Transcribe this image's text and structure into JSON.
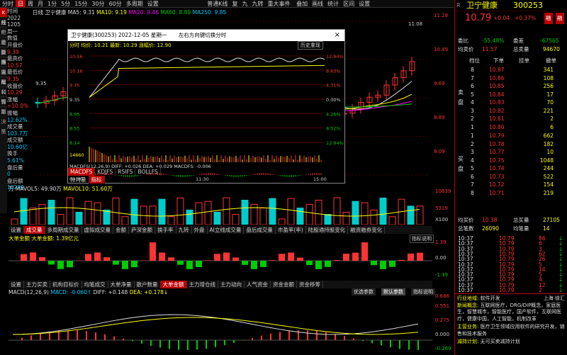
{
  "topbar": {
    "tabs": [
      "分时",
      "日",
      "周",
      "月",
      "1分",
      "5分",
      "15分",
      "30分",
      "60分",
      "多周期",
      "设置"
    ],
    "active": "日",
    "stock_label": "卫宁健康",
    "center": [
      "普通K线",
      "复",
      "九",
      "九转",
      "重大事件"
    ],
    "right_tools": [
      "叠加",
      "画线",
      "统计",
      "区间",
      "设置"
    ]
  },
  "left_tabs": [
    "K线",
    "分时",
    "个股资料",
    "港股通",
    "操作提醒",
    "资讯",
    "主题",
    "盈利预测",
    "公告",
    "智能决策"
  ],
  "info": {
    "date_label": "时间",
    "year": "2022",
    "mmdd": "1205",
    "weekday": "周一",
    "value_label": "数值",
    "open_label": "开盘价",
    "open": "9.39",
    "high_label": "最高价",
    "high": "10.57",
    "low_label": "最低价",
    "low": "9.35",
    "close_label": "收盘价",
    "close": "10.29",
    "chg_label": "涨幅",
    "chg": "+10.0%",
    "amp_label": "振幅",
    "amp": "12.62%",
    "vol_label": "成交量",
    "vol": "103.7万",
    "amt_label": "成交额",
    "amt": "10.60亿",
    "turn_label": "换手",
    "turn": "5.61%",
    "pvol_label": "盘后量",
    "pvol": "0",
    "pamt_label": "盘后额",
    "pamt": "10290"
  },
  "kline": {
    "ma_line": "日线 卫宁健康",
    "ma5": "MA5: 9.31",
    "ma10": "MA10: 9.19",
    "ma20": "MA20: 9.46",
    "ma60": "MA60: 8.89",
    "ma250": "MA250: 9.85",
    "high_mark": "11.08",
    "yaxis": [
      "11.28",
      "10.49",
      "9.69",
      "8.89",
      "8.09"
    ],
    "yaxis_left": "9.35"
  },
  "popup": {
    "title": "卫宁健康(300253) 2022-12-05 星期一",
    "hint": "左右方向键切换分时",
    "close": "×",
    "line": "分时 均价: 10.21 最新: 10.29 涨幅价: 12.90",
    "hist_btn": "历史重现",
    "left_prices": [
      "10.56",
      "10.16",
      "9.75",
      "9.35",
      "8.95",
      "8.55",
      "8.14"
    ],
    "right_pcts": [
      "12.94%",
      "8.63%",
      "4.31%",
      "0.00%",
      "4.26%",
      "8.52%",
      "12.94%"
    ],
    "vol_left": "14660",
    "macd_label": "MACDFS(12,26,9) DIFF: +0.026 DEA: +0.029 MACDFS: -0.006",
    "macd_vals": [
      "+0.172",
      "+0.049",
      "-0.076"
    ],
    "times": [
      "09:30",
      "11:30",
      "15:00"
    ],
    "tabs": [
      "MACDFS",
      "KDJFS",
      "RSIFS",
      "BOLLFS"
    ],
    "tabs2": [
      "分时量",
      "指标"
    ]
  },
  "vol": {
    "label": "万",
    "mavol5": "MAVOL5: 49.90万",
    "mavol10": "MAVOL10: 51.60万",
    "yaxis": [
      "10639",
      "5319",
      "X100"
    ]
  },
  "tabs1": [
    "设置",
    "成交量",
    "多周期成交量",
    "虚拟成交量",
    "金额",
    "庐深金额",
    "换手率",
    "九转",
    "外盘",
    "AI立线成交量",
    "盘后成交量",
    "市盈率(率)",
    "陆股通持股变化",
    "融资融券变化"
  ],
  "tabs1_active": "成交量",
  "bigorder": {
    "label": "大单金额 大单金额: 1.39亿元",
    "explain": "指标说明",
    "yaxis": [
      "1.39",
      "0.00",
      "-1.39"
    ]
  },
  "tabs2": [
    "设置",
    "主力买卖",
    "机构目标价",
    "均笔成交",
    "大单净量",
    "散户数量",
    "大单金额",
    "主力增仓线",
    "主力动向",
    "人气资金",
    "资金金额",
    "资金移筹"
  ],
  "tabs2_active": "大单金额",
  "macd": {
    "label": "MACD(12,26,9)",
    "macd": "MACD: -0.060↑",
    "diff": "DIFF: +0.148",
    "dea": "DEA: +0.178↓",
    "btn1": "优选参数",
    "btn2": "默认参数",
    "explain": "指标说明",
    "yaxis": [
      "0.686",
      "0.551",
      "0.275",
      "0.000",
      "-0.269"
    ]
  },
  "quote": {
    "name": "卫宁健康",
    "code": "300253",
    "price": "10.79",
    "chg": "+0.04",
    "pct": "+0.37%",
    "tag1": "融",
    "tag2": "融",
    "weibi_label": "委比",
    "weibi": "-55.48%",
    "weicha_label": "委差",
    "weicha": "-67565",
    "jmr": "均买价",
    "jmr_val": "10.82",
    "jsell": "均卖价",
    "jsell_val": "11.57",
    "zmml_label": "总卖量",
    "zmml": "94670",
    "sell": [
      [
        "8",
        "10.87",
        "341"
      ],
      [
        "7",
        "10.86",
        "108"
      ],
      [
        "6",
        "10.85",
        "256"
      ],
      [
        "5",
        "10.84",
        "17"
      ],
      [
        "4",
        "10.83",
        "70"
      ],
      [
        "3",
        "10.82",
        "221"
      ],
      [
        "2",
        "10.81",
        "2"
      ],
      [
        "1",
        "10.80",
        "6"
      ]
    ],
    "buy": [
      [
        "1",
        "10.79",
        "662"
      ],
      [
        "2",
        "10.78",
        "182"
      ],
      [
        "3",
        "10.77",
        "10"
      ],
      [
        "4",
        "10.75",
        "1048"
      ],
      [
        "5",
        "10.74",
        "244"
      ],
      [
        "6",
        "10.73",
        "522"
      ],
      [
        "7",
        "10.72",
        "154"
      ],
      [
        "8",
        "10.71",
        "219"
      ]
    ],
    "col_hdr": [
      "档位",
      "下单",
      "",
      "挂单",
      "撤单"
    ],
    "side_sell": "卖盘",
    "side_buy": "买盘",
    "jmr2_label": "均买价",
    "jmr2": "10.38",
    "zmrl_label": "总买量",
    "zmrl": "27105",
    "zbz_label": "总笔数",
    "zbz": "26090",
    "jbz_label": "均笔量",
    "jbz": "14",
    "ticks": [
      [
        "10:37",
        "10.79",
        "86"
      ],
      [
        "10:37",
        "10.79",
        "6"
      ],
      [
        "10:37",
        "10.79",
        "3"
      ],
      [
        "10:37",
        "10.79",
        "62"
      ],
      [
        "10:37",
        "10.79",
        "26"
      ],
      [
        "10:37",
        "10.79",
        "5"
      ],
      [
        "10:37",
        "10.79",
        "14"
      ],
      [
        "10:37",
        "10.79",
        "5"
      ],
      [
        "10:37",
        "10.79",
        "4"
      ],
      [
        "10:37",
        "10.79",
        "12"
      ],
      [
        "10:37",
        "10.79",
        "2"
      ]
    ],
    "industry_label": "行业地域:",
    "industry": "软件开发",
    "region": "上海·徐汇",
    "concept_label": "新闻概念:",
    "concept": "互联网医疗，DRG/DIP概念，家庭医生，智慧城市，智能医疗，国产软件，互联网医疗，健康中国，人工智能，机制改革",
    "business_label": "主营业务:",
    "business": "医疗卫生领域应用软件的研究开发，销售和技术服务",
    "plan_label": "减持计划:",
    "plan": "无可买卖减持计划"
  },
  "colors": {
    "up": "#ff3333",
    "down": "#00cc00",
    "bg": "#000000",
    "accent": "#b00000"
  }
}
